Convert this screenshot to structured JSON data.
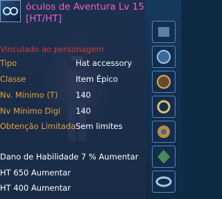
{
  "item": {
    "title_line1": "óculos de Aventura Lv 15",
    "title_line2": "[HT/HT]",
    "bound_text": "Vinculado ao personagem",
    "title_color": "#ef5fd0",
    "label_color": "#e7a13d",
    "bound_color": "#d03c3c"
  },
  "attributes": [
    {
      "label": "Tipo",
      "value": "Hat accessory"
    },
    {
      "label": "Classe",
      "value": "Item Épico"
    },
    {
      "label": "Nv. Mínimo (T)",
      "value": "140"
    },
    {
      "label": "Nv Mínimo Digi",
      "value": "140"
    },
    {
      "label": "Obtenção Limitada",
      "value": "Sem limites"
    }
  ],
  "bonuses": [
    "Dano de Habilidade 7 % Aumentar",
    "HT 650 Aumentar",
    "HT 400 Aumentar"
  ],
  "slot_icons": [
    "equipment-slot-icon",
    "round-accessory-icon",
    "medal-icon",
    "ring-icon",
    "compass-icon",
    "gem-icon",
    "bracelet-icon",
    "badge-icon",
    "charm-icon"
  ]
}
